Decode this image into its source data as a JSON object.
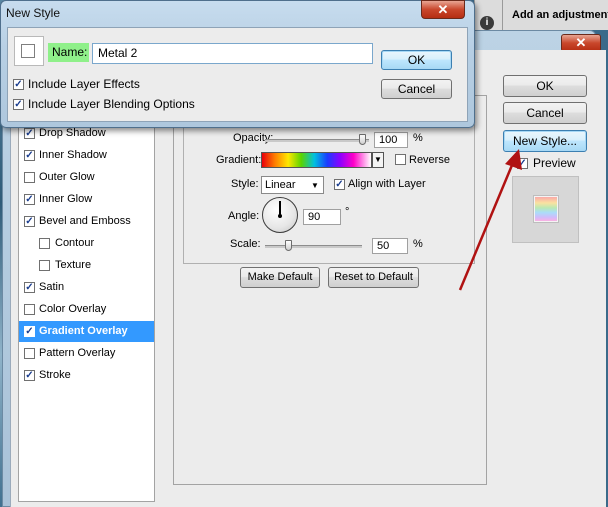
{
  "adjustments_panel": {
    "title": "Add an adjustment",
    "icon": "info-icon"
  },
  "new_style_dialog": {
    "title": "New Style",
    "name_label": "Name:",
    "name_value": "Metal 2",
    "include_layer_effects": {
      "label": "Include Layer Effects",
      "checked": true
    },
    "include_blending": {
      "label": "Include Layer Blending Options",
      "checked": true
    },
    "ok_label": "OK",
    "cancel_label": "Cancel"
  },
  "layer_style": {
    "styles": [
      {
        "label": "Drop Shadow",
        "checked": true
      },
      {
        "label": "Inner Shadow",
        "checked": true
      },
      {
        "label": "Outer Glow",
        "checked": false
      },
      {
        "label": "Inner Glow",
        "checked": true
      },
      {
        "label": "Bevel and Emboss",
        "checked": true
      },
      {
        "label": "Contour",
        "checked": false,
        "sub": true
      },
      {
        "label": "Texture",
        "checked": false,
        "sub": true
      },
      {
        "label": "Satin",
        "checked": true
      },
      {
        "label": "Color Overlay",
        "checked": false
      },
      {
        "label": "Gradient Overlay",
        "checked": true,
        "selected": true
      },
      {
        "label": "Pattern Overlay",
        "checked": false
      },
      {
        "label": "Stroke",
        "checked": true
      }
    ],
    "gradient_overlay": {
      "opacity_label": "Opacity:",
      "opacity_value": "100",
      "opacity_unit": "%",
      "gradient_label": "Gradient:",
      "reverse_label": "Reverse",
      "reverse_checked": false,
      "style_label": "Style:",
      "style_value": "Linear",
      "align_label": "Align with Layer",
      "align_checked": true,
      "angle_label": "Angle:",
      "angle_value": "90",
      "angle_unit": "°",
      "scale_label": "Scale:",
      "scale_value": "50",
      "scale_unit": "%",
      "make_default_label": "Make Default",
      "reset_default_label": "Reset to Default"
    },
    "ok_label": "OK",
    "cancel_label": "Cancel",
    "new_style_label": "New Style...",
    "preview_label": "Preview",
    "preview_checked": true
  },
  "colors": {
    "selection": "#3399ff",
    "annotation_arrow": "#b01212",
    "name_highlight": "#8ff08a"
  }
}
